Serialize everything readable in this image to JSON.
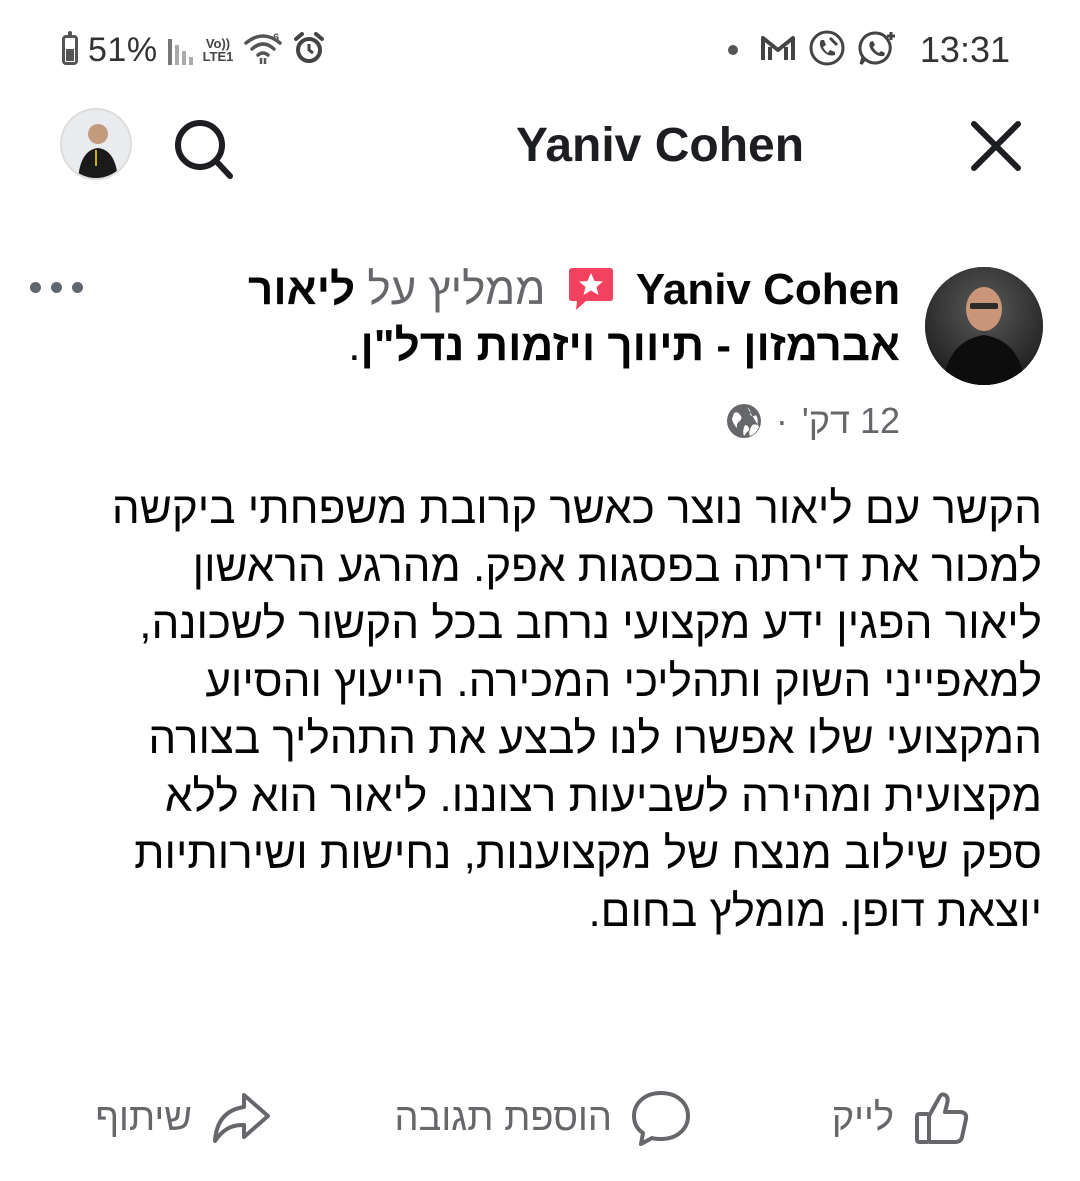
{
  "status_bar": {
    "battery_percent": "51%",
    "volte_label_top": "Vo))",
    "volte_label_bottom": "LTE1",
    "wifi_badge": "6",
    "time": "13:31",
    "right_icons": [
      "dot-icon",
      "gmail-icon",
      "phone-call-icon",
      "whatsapp-icon"
    ],
    "left_icons": [
      "battery-icon",
      "signal-icon",
      "volte-icon",
      "wifi-icon",
      "alarm-icon"
    ]
  },
  "header": {
    "title": "Yaniv Cohen",
    "icons": [
      "avatar",
      "search-icon",
      "close-icon"
    ]
  },
  "post": {
    "author": "Yaniv Cohen",
    "recommends_text": "ממליץ על",
    "recommended_page": "ליאור אברמזון - תיווך ויזמות נדל\"ן",
    "period": ".",
    "time_ago": "12 דק'",
    "separator": "·",
    "privacy_icon": "globe-icon",
    "badge_color": "#f3425f",
    "body_lines": [
      "הקשר עם ליאור נוצר כאשר קרובת משפחתי ביקשה",
      "למכור את דירתה בפסגות אפק. מהרגע הראשון",
      "ליאור הפגין ידע מקצועי נרחב בכל הקשור לשכונה,",
      "למאפייני השוק ותהליכי המכירה. הייעוץ והסיוע",
      "המקצועי שלו אפשרו לנו לבצע את התהליך בצורה",
      "מקצועית ומהירה לשביעות רצוננו. ליאור הוא ללא",
      "ספק שילוב מנצח של מקצוענות, נחישות ושירותיות",
      "יוצאת דופן. מומלץ בחום."
    ]
  },
  "actions": {
    "like": "לייק",
    "comment": "הוספת תגובה",
    "share": "שיתוף"
  }
}
